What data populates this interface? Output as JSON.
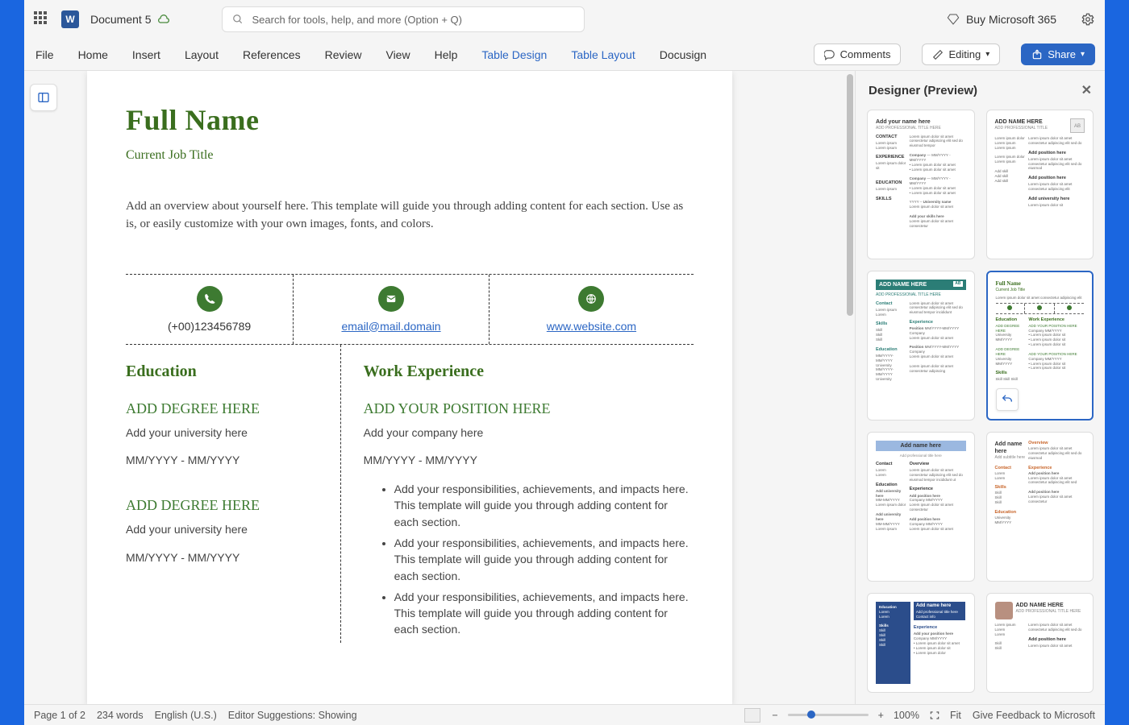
{
  "titlebar": {
    "doc_title": "Document 5",
    "search_placeholder": "Search for tools, help, and more (Option + Q)",
    "buy_label": "Buy Microsoft 365"
  },
  "ribbon": {
    "tabs": {
      "file": "File",
      "home": "Home",
      "insert": "Insert",
      "layout": "Layout",
      "references": "References",
      "review": "Review",
      "view": "View",
      "help": "Help",
      "table_design": "Table Design",
      "table_layout": "Table Layout",
      "docusign": "Docusign"
    },
    "comments": "Comments",
    "editing": "Editing",
    "share": "Share"
  },
  "doc": {
    "full_name": "Full Name",
    "job_title": "Current Job Title",
    "overview": "Add an overview about yourself here. This template will guide you through adding content for each section. Use as is, or easily customize with your own images, fonts, and colors.",
    "contact": {
      "phone": "(+00)123456789",
      "email": "email@mail.domain",
      "website": "www.website.com"
    },
    "education": {
      "header": "Education",
      "degree1": "ADD DEGREE HERE",
      "univ1": "Add your university here",
      "dates1": "MM/YYYY - MM/YYYY",
      "degree2": "ADD DEGREE HERE",
      "univ2": "Add your university here",
      "dates2": "MM/YYYY - MM/YYYY"
    },
    "work": {
      "header": "Work Experience",
      "position": "ADD YOUR POSITION HERE",
      "company": "Add your company here",
      "dates": "MM/YYYY - MM/YYYY",
      "bullet1": "Add your responsibilities, achievements, and impacts here. This template will guide you through adding content for each section.",
      "bullet2": "Add your responsibilities, achievements, and impacts here. This template will guide you through adding content for each section.",
      "bullet3": "Add your responsibilities, achievements, and impacts here. This template will guide you through adding content for each section."
    }
  },
  "designer": {
    "title": "Designer (Preview)"
  },
  "statusbar": {
    "page": "Page 1 of 2",
    "words": "234 words",
    "language": "English (U.S.)",
    "suggestions": "Editor Suggestions: Showing",
    "zoom": "100%",
    "fit": "Fit",
    "feedback": "Give Feedback to Microsoft"
  }
}
